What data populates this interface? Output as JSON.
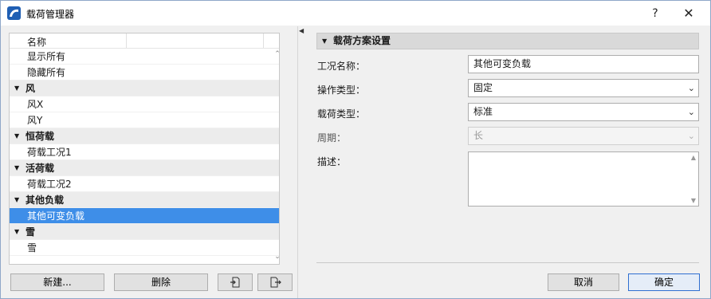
{
  "window": {
    "title": "载荷管理器",
    "help_label": "?",
    "close_label": "✕"
  },
  "tree": {
    "column_header": "名称",
    "top_items": [
      "显示所有",
      "隐藏所有"
    ],
    "groups": [
      {
        "label": "风",
        "items": [
          "风X",
          "风Y"
        ]
      },
      {
        "label": "恒荷载",
        "items": [
          "荷载工况1"
        ]
      },
      {
        "label": "活荷载",
        "items": [
          "荷载工况2"
        ]
      },
      {
        "label": "其他负载",
        "items": [
          "其他可变负载"
        ]
      },
      {
        "label": "雪",
        "items": [
          "雪"
        ]
      }
    ],
    "selected_item": "其他可变负载"
  },
  "left_buttons": {
    "new_label": "新建...",
    "delete_label": "删除",
    "import_icon": "import-icon",
    "export_icon": "export-icon"
  },
  "panel": {
    "section_title": "载荷方案设置",
    "fields": {
      "case_name_label": "工况名称：",
      "case_name_value": "其他可变负载",
      "operation_type_label": "操作类型：",
      "operation_type_value": "固定",
      "load_type_label": "载荷类型：",
      "load_type_value": "标准",
      "period_label": "周期：",
      "period_value": "长",
      "description_label": "描述："
    }
  },
  "footer": {
    "cancel_label": "取消",
    "ok_label": "确定"
  },
  "colors": {
    "selection": "#3e8ee8",
    "group_bg": "#ececec",
    "primary_border": "#2f6fd0"
  }
}
